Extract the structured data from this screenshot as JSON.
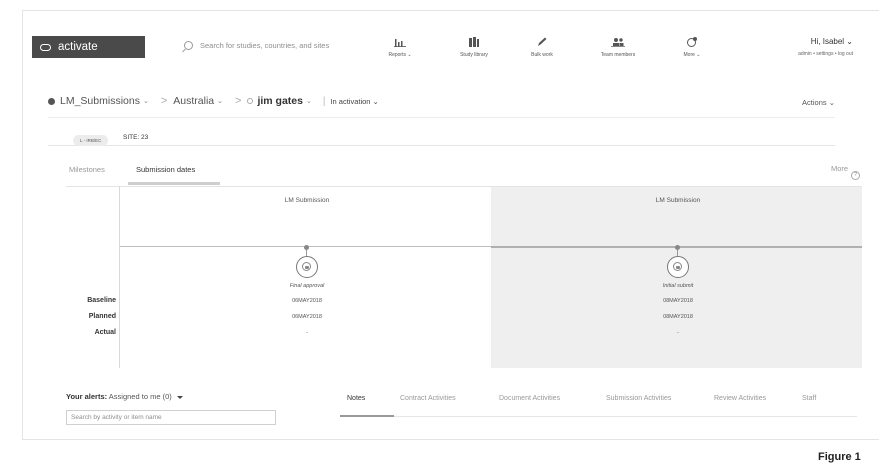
{
  "app": {
    "logo_text": "activate",
    "search_placeholder": "Search for studies, countries, and sites"
  },
  "nav": [
    {
      "label": "Reports ⌄",
      "icon": "reports-icon"
    },
    {
      "label": "Study library",
      "icon": "library-icon"
    },
    {
      "label": "Bulk work",
      "icon": "pencil-icon"
    },
    {
      "label": "Team members",
      "icon": "team-icon"
    },
    {
      "label": "More ⌄",
      "icon": "more-icon"
    }
  ],
  "user": {
    "greeting": "Hi, Isabel ⌄",
    "links": "admin • settings • log out"
  },
  "breadcrumb": {
    "study": "LM_Submissions",
    "country": "Australia",
    "site_person": "jim gates",
    "status": "In activation ⌄",
    "actions": "Actions ⌄"
  },
  "site_badge": "L - IRB/EC",
  "site_label": "SITE: 23",
  "tabs": {
    "milestones": "Milestones",
    "submission_dates": "Submission dates",
    "more": "More",
    "help": "?"
  },
  "timeline": {
    "columns": [
      {
        "header": "LM Submission",
        "milestone": "Final approval",
        "baseline": "06MAY2018",
        "planned": "06MAY2018",
        "actual": "-"
      },
      {
        "header": "LM Submission",
        "milestone": "Initial submit",
        "baseline": "08MAY2018",
        "planned": "08MAY2018",
        "actual": "-"
      }
    ],
    "row_labels": {
      "baseline": "Baseline",
      "planned": "Planned",
      "actual": "Actual"
    }
  },
  "alerts": {
    "title": "Your alerts:",
    "filter": "Assigned to me (0)",
    "search_placeholder": "Search by activity or item name"
  },
  "bottom_tabs": [
    "Notes",
    "Contract Activities",
    "Document Activities",
    "Submission Activities",
    "Review Activities",
    "Staff"
  ],
  "figure_caption": "Figure 1"
}
